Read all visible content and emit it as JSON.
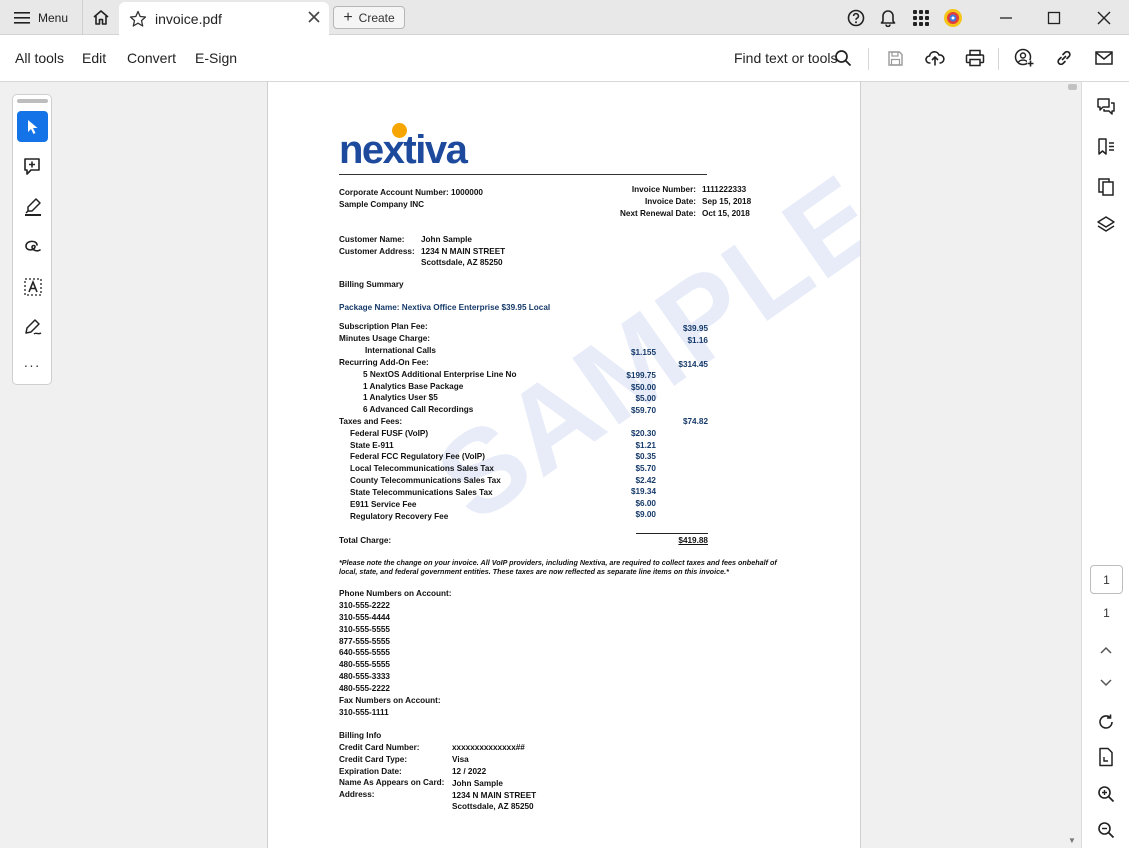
{
  "titlebar": {
    "menu_label": "Menu",
    "tab_title": "invoice.pdf",
    "create_label": "Create"
  },
  "toolbar": {
    "items": [
      "All tools",
      "Edit",
      "Convert",
      "E-Sign"
    ],
    "find_label": "Find text or tools"
  },
  "page_nav": {
    "current_page": "1",
    "total_pages": "1"
  },
  "document": {
    "logo_text": "nextiva",
    "account": {
      "corporate_account": "Corporate Account Number: 1000000",
      "company": "Sample Company INC"
    },
    "invoice_meta": {
      "number_label": "Invoice Number:",
      "number": "1111222333",
      "date_label": "Invoice Date:",
      "date": "Sep 15, 2018",
      "renewal_label": "Next Renewal Date:",
      "renewal": "Oct 15, 2018"
    },
    "customer": {
      "name_label": "Customer Name:",
      "name": "John Sample",
      "address_label": "Customer Address:",
      "address_line1": "1234 N MAIN STREET",
      "address_line2": "Scottsdale, AZ 85250"
    },
    "billing_summary_heading": "Billing Summary",
    "package_name": "Package Name: Nextiva Office Enterprise $39.95 Local",
    "charges": [
      {
        "label": "Subscription Plan Fee:",
        "sub": "",
        "total": "$39.95"
      },
      {
        "label": "Minutes Usage Charge:",
        "sub": "",
        "total": "$1.16"
      },
      {
        "label": "International Calls",
        "sub": "$1.155",
        "total": ""
      },
      {
        "label": "Recurring Add-On Fee:",
        "sub": "",
        "total": "$314.45"
      },
      {
        "label": "5 NextOS Additional Enterprise Line No",
        "sub": "$199.75",
        "total": ""
      },
      {
        "label": "1 Analytics Base Package",
        "sub": "$50.00",
        "total": ""
      },
      {
        "label": "1 Analytics User $5",
        "sub": "$5.00",
        "total": ""
      },
      {
        "label": "6 Advanced Call Recordings",
        "sub": "$59.70",
        "total": ""
      },
      {
        "label": "Taxes and Fees:",
        "sub": "",
        "total": "$74.82"
      },
      {
        "label": "Federal FUSF (VoIP)",
        "sub": "$20.30",
        "total": ""
      },
      {
        "label": "State E-911",
        "sub": "$1.21",
        "total": ""
      },
      {
        "label": "Federal FCC Regulatory Fee (VoIP)",
        "sub": "$0.35",
        "total": ""
      },
      {
        "label": "Local Telecommunications Sales Tax",
        "sub": "$5.70",
        "total": ""
      },
      {
        "label": "County Telecommunications Sales Tax",
        "sub": "$2.42",
        "total": ""
      },
      {
        "label": "State Telecommunications Sales Tax",
        "sub": "$19.34",
        "total": ""
      },
      {
        "label": "E911 Service Fee",
        "sub": "$6.00",
        "total": ""
      },
      {
        "label": "Regulatory Recovery Fee",
        "sub": "$9.00",
        "total": ""
      }
    ],
    "total_label": "Total Charge:",
    "total_value": "$419.88",
    "note_line1": "*Please note the change on your invoice. All VoIP providers, including Nextiva, are required to collect taxes and fees onbehalf of",
    "note_line2": "local, state, and federal government entities. These taxes are now reflected as separate line items on this invoice.*",
    "phone_heading": "Phone Numbers on Account:",
    "phones": [
      "310-555-2222",
      "310-555-4444",
      "310-555-5555",
      "877-555-5555",
      "640-555-5555",
      "480-555-5555",
      "480-555-3333",
      "480-555-2222"
    ],
    "fax_heading": "Fax Numbers on Account:",
    "fax": "310-555-1111",
    "billing_info_heading": "Billing Info",
    "billing_info": [
      {
        "label": "Credit Card Number:",
        "value": "xxxxxxxxxxxxxx##"
      },
      {
        "label": "Credit Card Type:",
        "value": "Visa"
      },
      {
        "label": "Expiration Date:",
        "value": "12 / 2022"
      },
      {
        "label": "Name As Appears on Card:",
        "value": "John Sample"
      },
      {
        "label": "Address:",
        "value": "1234 N MAIN STREET"
      },
      {
        "label": "",
        "value": "Scottsdale, AZ 85250"
      }
    ],
    "watermark": "SAMPLE"
  }
}
